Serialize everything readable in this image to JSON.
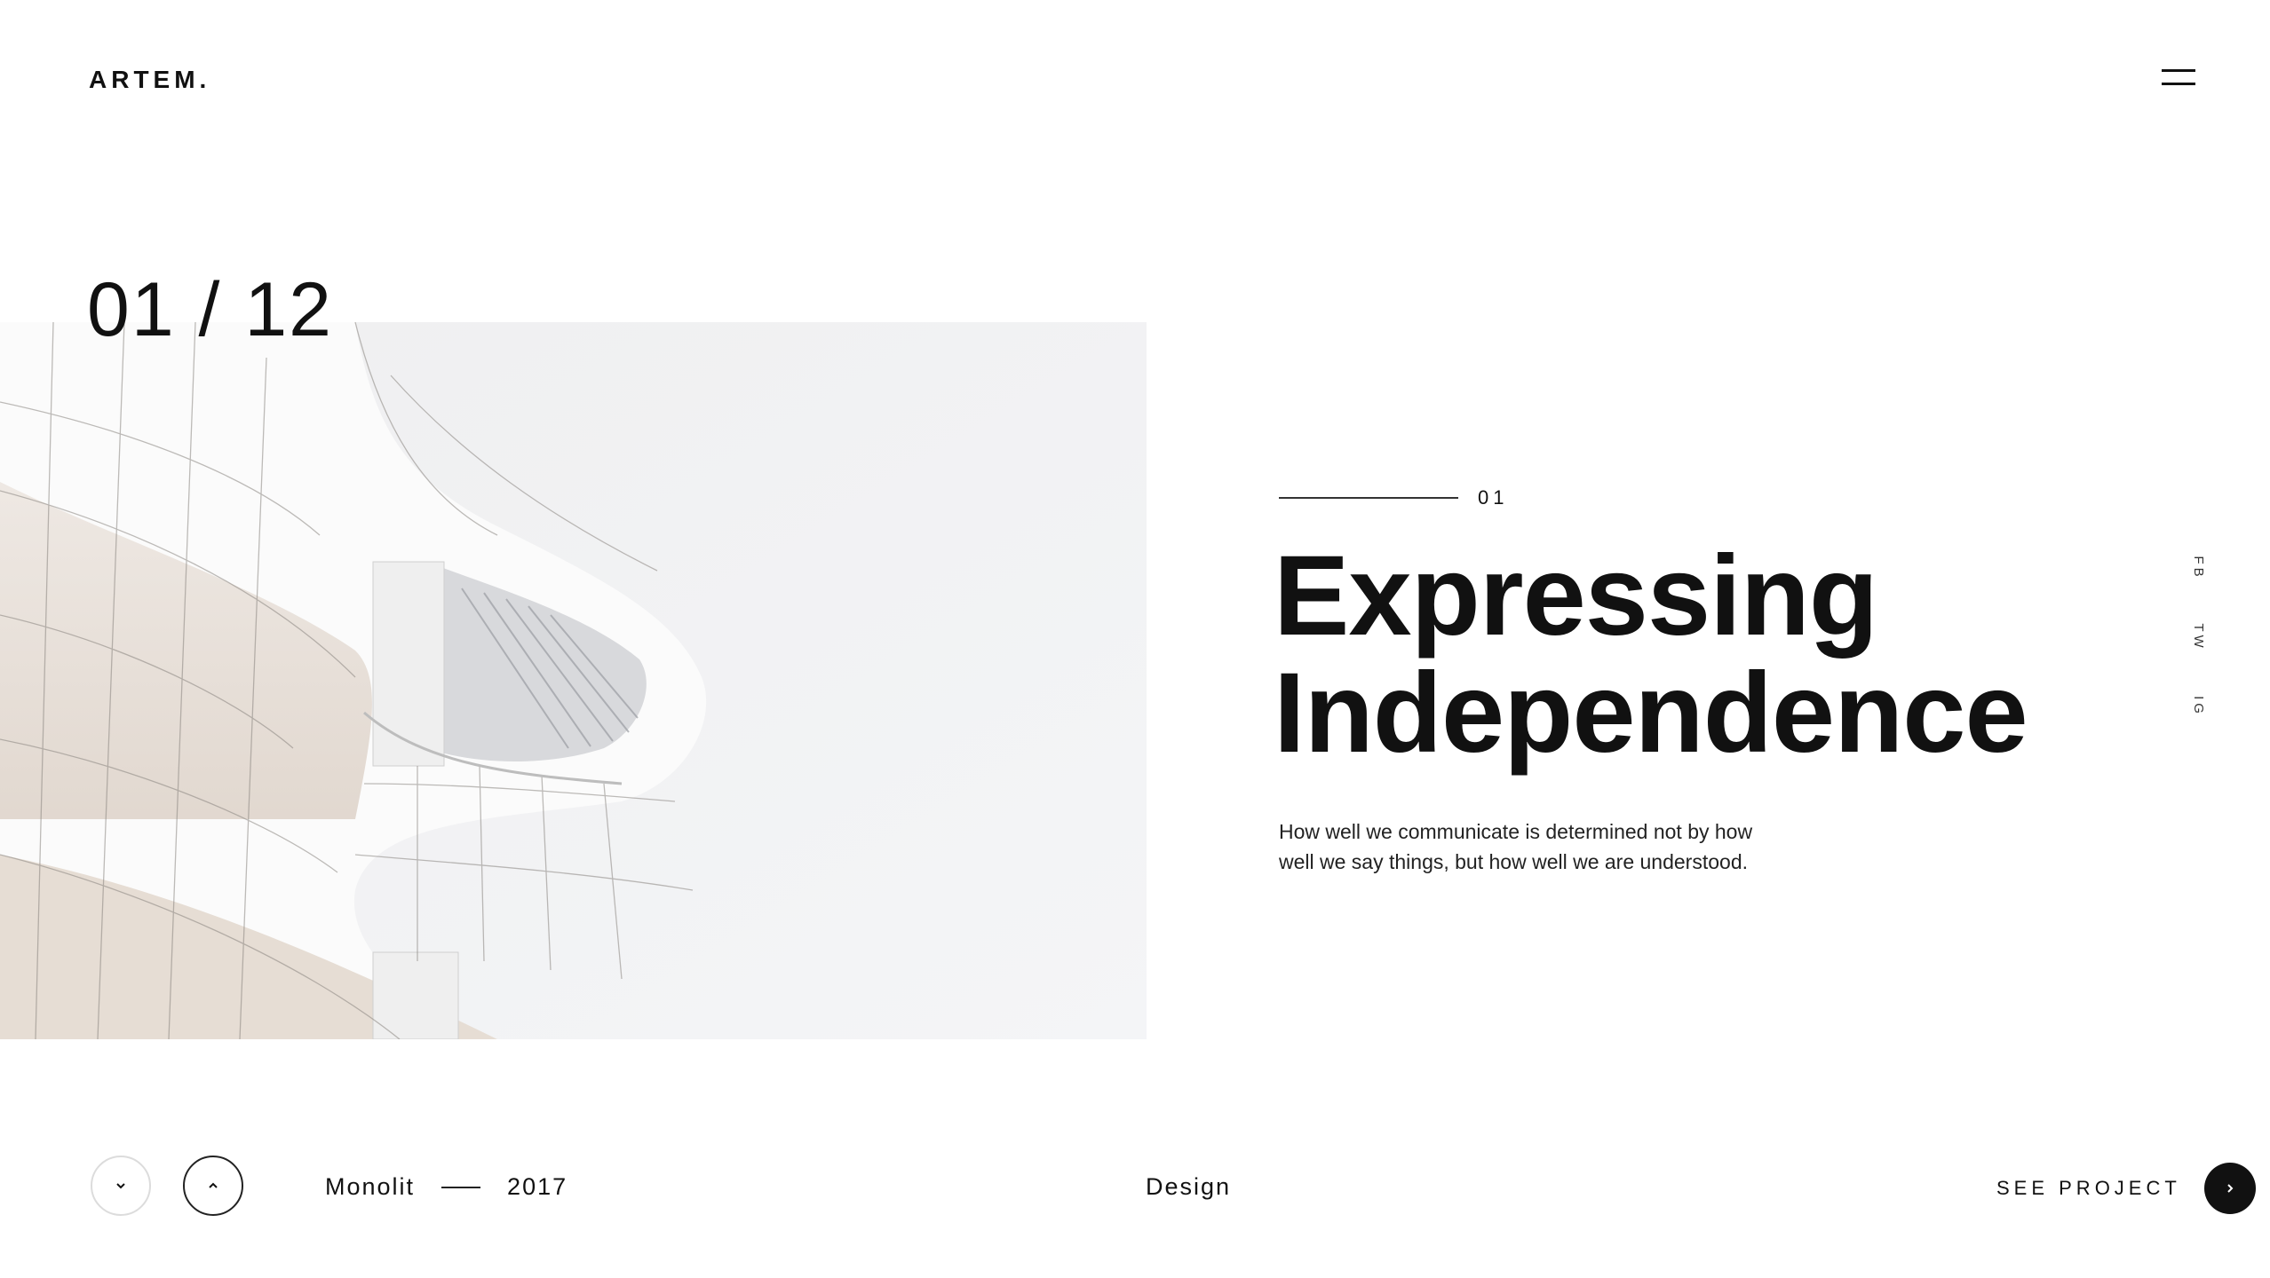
{
  "header": {
    "logo": "ARTEM."
  },
  "hero": {
    "counter": "01 / 12",
    "slide_number": "01",
    "headline_line1": "Expressing",
    "headline_line2": "Independence",
    "description": "How well we communicate is determined not by how well we say things, but how well we are understood."
  },
  "social": {
    "items": [
      "FB",
      "TW",
      "IG"
    ]
  },
  "footer": {
    "project_name": "Monolit",
    "project_year": "2017",
    "category": "Design",
    "see_project_label": "SEE PROJECT"
  }
}
